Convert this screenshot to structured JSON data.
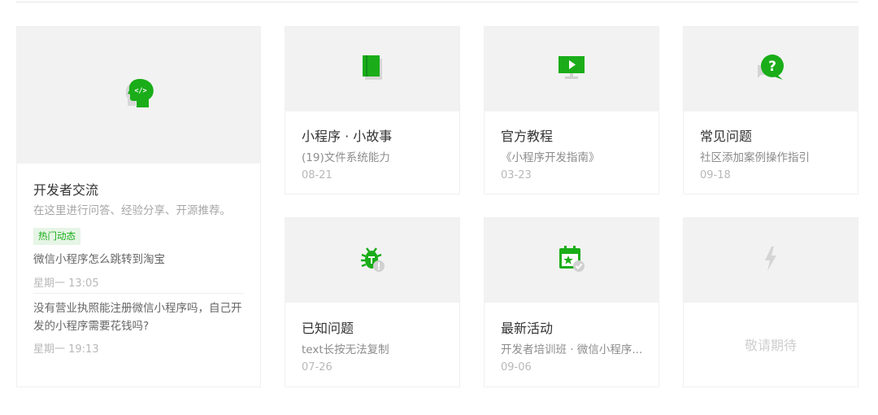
{
  "dev_card": {
    "title": "开发者交流",
    "subtitle": "在这里进行问答、经验分享、开源推荐。",
    "badge": "热门动态",
    "posts": [
      {
        "text": "微信小程序怎么跳转到淘宝",
        "time": "星期一 13:05"
      },
      {
        "text": "没有营业执照能注册微信小程序吗，自己开发的小程序需要花钱吗?",
        "time": "星期一 19:13"
      }
    ]
  },
  "cards": [
    {
      "title": "小程序 · 小故事",
      "subtitle": "(19)文件系统能力",
      "date": "08-21",
      "icon": "book-icon"
    },
    {
      "title": "官方教程",
      "subtitle": "《小程序开发指南》",
      "date": "03-23",
      "icon": "video-screen-icon"
    },
    {
      "title": "常见问题",
      "subtitle": "社区添加案例操作指引",
      "date": "09-18",
      "icon": "question-bubble-icon"
    },
    {
      "title": "已知问题",
      "subtitle": "text长按无法复制",
      "date": "07-26",
      "icon": "bug-icon"
    },
    {
      "title": "最新活动",
      "subtitle": "开发者培训班 · 微信小程序...",
      "date": "09-06",
      "icon": "calendar-star-icon"
    }
  ],
  "placeholder_card": {
    "text": "敬请期待",
    "icon": "lightning-icon"
  },
  "colors": {
    "accent": "#1aad19",
    "thumb_bg": "#f2f2f2",
    "muted_icon": "#d5d5d5"
  }
}
